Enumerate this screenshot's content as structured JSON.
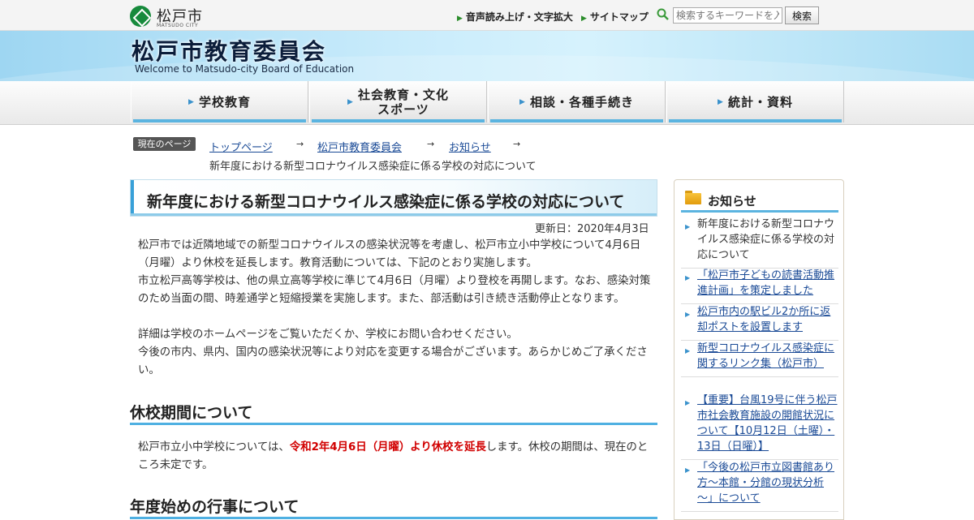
{
  "header": {
    "logo_jp": "松戸市",
    "logo_en": "MATSUDO CITY",
    "read_aloud": "音声読み上げ・文字拡大",
    "sitemap": "サイトマップ",
    "search_placeholder": "検索するキーワードを入",
    "search_button": "検索"
  },
  "banner": {
    "title": "松戸市教育委員会",
    "subtitle": "Welcome to Matsudo-city Board of Education"
  },
  "gnav": [
    "学校教育",
    "社会教育・文化\nスポーツ",
    "相談・各種手続き",
    "統計・資料"
  ],
  "breadcrumb": {
    "label": "現在のページ",
    "items": [
      "トップページ",
      "松戸市教育委員会",
      "お知らせ"
    ],
    "current": "新年度における新型コロナウイルス感染症に係る学校の対応について"
  },
  "article": {
    "title": "新年度における新型コロナウイルス感染症に係る学校の対応について",
    "updated": "更新日：2020年4月3日",
    "paragraphs": [
      "松戸市では近隣地域での新型コロナウイルスの感染状況等を考慮し、松戸市立小中学校について4月6日（月曜）より休校を延長します。教育活動については、下記のとおり実施します。",
      "市立松戸高等学校は、他の県立高等学校に準じて4月6日（月曜）より登校を再開します。なお、感染対策のため当面の間、時差通学と短縮授業を実施します。また、部活動は引き続き活動停止となります。",
      "詳細は学校のホームページをご覧いただくか、学校にお問い合わせください。",
      "今後の市内、県内、国内の感染状況等により対応を変更する場合がございます。あらかじめご了承ください。"
    ],
    "h2_closure": "休校期間について",
    "closure_before": "松戸市立小中学校については、",
    "closure_red": "令和2年4月6日（月曜）より休校を延長",
    "closure_after": "します。休校の期間は、現在のところ未定です。",
    "h2_events": "年度始めの行事について"
  },
  "sidebar": {
    "title": "お知らせ",
    "items": [
      "新年度における新型コロナウイルス感染症に係る学校の対応について",
      "「松戸市子どもの読書活動推進計画」を策定しました",
      "松戸市内の駅ビル2か所に返却ポストを設置します",
      "新型コロナウイルス感染症に関するリンク集（松戸市）",
      "【重要】台風19号に伴う松戸市社会教育施設の開館状況について【10月12日（土曜）・13日（日曜）】",
      "「今後の松戸市立図書館あり方～本館・分館の現状分析～」について"
    ]
  },
  "colors": {
    "accent": "#3a92cc",
    "link": "#1a4a96",
    "warning": "#d10000",
    "logo_green": "#178a3c"
  }
}
